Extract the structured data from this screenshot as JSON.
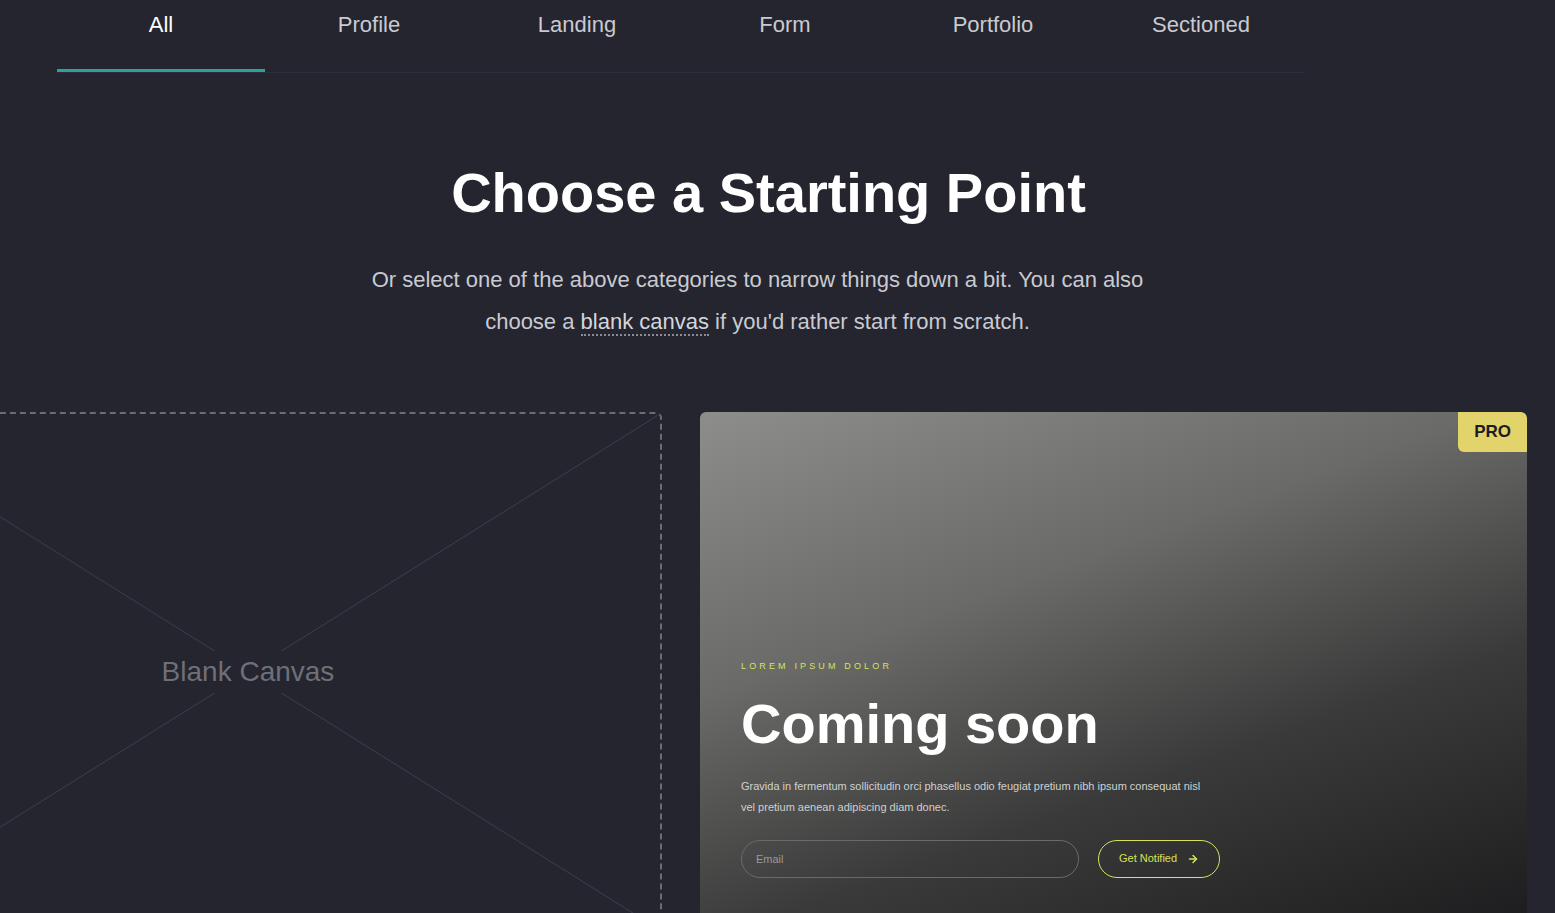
{
  "tabs": [
    {
      "label": "All",
      "selected": true
    },
    {
      "label": "Profile",
      "selected": false
    },
    {
      "label": "Landing",
      "selected": false
    },
    {
      "label": "Form",
      "selected": false
    },
    {
      "label": "Portfolio",
      "selected": false
    },
    {
      "label": "Sectioned",
      "selected": false
    }
  ],
  "heading": "Choose a Starting Point",
  "subtitle": {
    "before": "Or select one of the above categories to narrow things down a bit. You can also choose a ",
    "link": "blank canvas",
    "after": " if you'd rather start from scratch."
  },
  "blank_canvas": {
    "label": "Blank Canvas"
  },
  "template_card": {
    "badge": "PRO",
    "eyebrow": "LOREM IPSUM DOLOR",
    "title": "Coming soon",
    "description": "Gravida in fermentum sollicitudin orci phasellus odio feugiat pretium nibh ipsum consequat nisl vel pretium aenean adipiscing diam donec.",
    "email_placeholder": "Email",
    "button": "Get Notified"
  }
}
